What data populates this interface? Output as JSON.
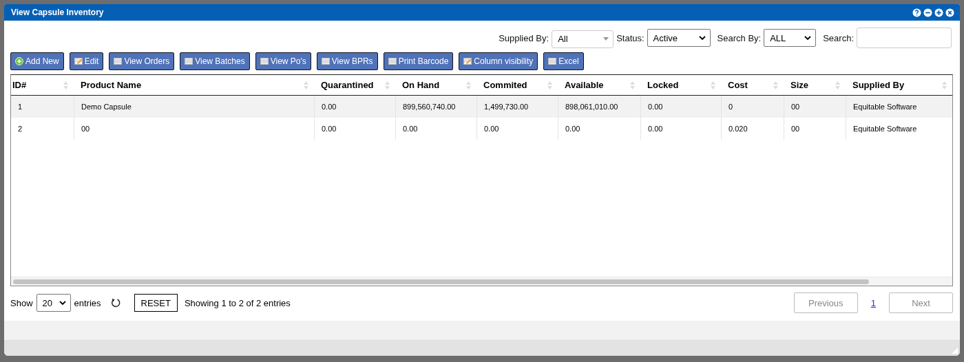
{
  "window": {
    "title": "View Capsule Inventory",
    "controls": [
      {
        "kind": "help"
      },
      {
        "kind": "minimize"
      },
      {
        "kind": "maximize"
      },
      {
        "kind": "close"
      }
    ]
  },
  "filters": [
    {
      "label": "Supplied By:",
      "kind": "combo",
      "value": "All"
    },
    {
      "label": "Status:",
      "kind": "select",
      "value": "Active"
    },
    {
      "label": "Search By:",
      "kind": "select",
      "value": "ALL"
    },
    {
      "label": "Search:",
      "kind": "input"
    }
  ],
  "buttons": [
    {
      "label": "Add New",
      "kind": "add"
    },
    {
      "label": "Edit",
      "kind": "edit"
    },
    {
      "label": "View Orders",
      "kind": "table"
    },
    {
      "label": "View Batches",
      "kind": "table"
    },
    {
      "label": "View Po's",
      "kind": "table"
    },
    {
      "label": "View BPRs",
      "kind": "table"
    },
    {
      "label": "Print Barcode",
      "kind": "table"
    },
    {
      "label": "Column visibility",
      "kind": "edit"
    },
    {
      "label": "Excel",
      "kind": "table"
    }
  ],
  "table": {
    "columns": [
      "ID#",
      "Product Name",
      "Quarantined",
      "On Hand",
      "Commited",
      "Available",
      "Locked",
      "Cost",
      "Size",
      "Supplied By"
    ],
    "rows": [
      [
        "1",
        "Demo Capsule",
        "0.00",
        "899,560,740.00",
        "1,499,730.00",
        "898,061,010.00",
        "0.00",
        "0",
        "00",
        "Equitable Software"
      ],
      [
        "2",
        "00",
        "0.00",
        "0.00",
        "0.00",
        "0.00",
        "0.00",
        "0.020",
        "00",
        "Equitable Software"
      ]
    ]
  },
  "footer": {
    "show_label": "Show",
    "page_size": "20",
    "entries_label": "entries",
    "reset": "RESET",
    "info": "Showing 1 to 2 of 2 entries"
  },
  "pagination": {
    "previous": {
      "label": "Previous",
      "disabled": true
    },
    "pages": [
      {
        "label": "1",
        "selected": true
      }
    ],
    "next": {
      "label": "Next",
      "disabled": true
    }
  }
}
